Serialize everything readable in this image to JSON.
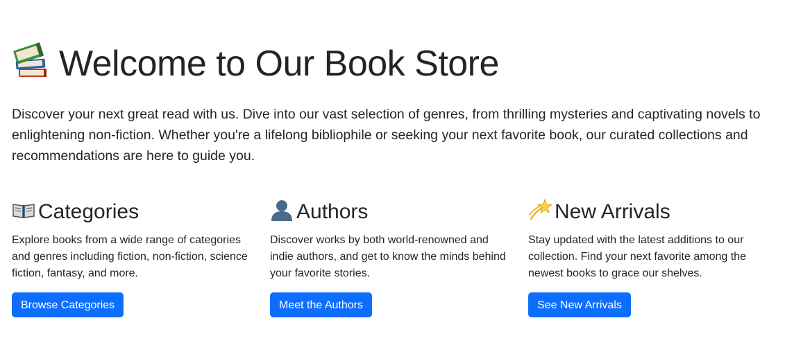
{
  "hero": {
    "icon": "books-icon",
    "title": "Welcome to Our Book Store",
    "lead": "Discover your next great read with us. Dive into our vast selection of genres, from thrilling mysteries and captivating novels to enlightening non-fiction. Whether you're a lifelong bibliophile or seeking your next favorite book, our curated collections and recommendations are here to guide you."
  },
  "features": [
    {
      "icon": "open-book-icon",
      "title": "Categories",
      "text": "Explore books from a wide range of categories and genres including fiction, non-fiction, science fiction, fantasy, and more.",
      "button": "Browse Categories"
    },
    {
      "icon": "person-silhouette-icon",
      "title": "Authors",
      "text": "Discover works by both world-renowned and indie authors, and get to know the minds behind your favorite stories.",
      "button": "Meet the Authors"
    },
    {
      "icon": "dizzy-star-icon",
      "title": "New Arrivals",
      "text": "Stay updated with the latest additions to our collection. Find your next favorite among the newest books to grace our shelves.",
      "button": "See New Arrivals"
    }
  ],
  "colors": {
    "primary_button": "#0d6efd",
    "text": "#212529",
    "background": "#ffffff"
  }
}
